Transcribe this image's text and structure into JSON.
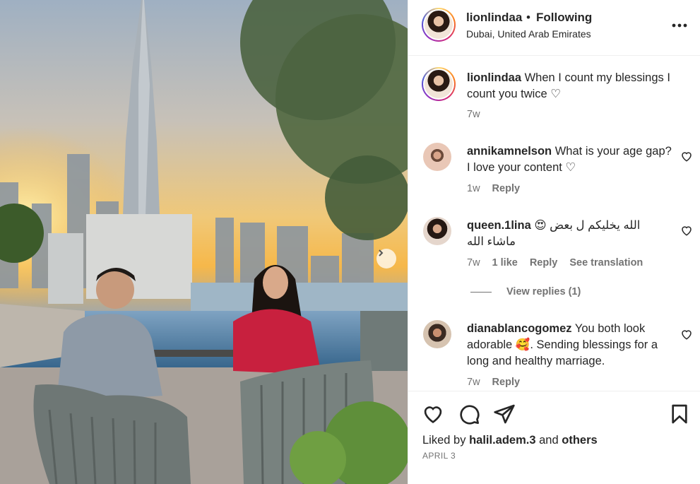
{
  "post": {
    "username": "lionlindaa",
    "separator": "•",
    "follow_status": "Following",
    "location": "Dubai, United Arab Emirates"
  },
  "caption": {
    "username": "lionlindaa",
    "text": "When I count my blessings I count you twice ♡",
    "time": "7w"
  },
  "comments": [
    {
      "username": "annikamnelson",
      "text": "What is your age gap? I love your content ♡",
      "time": "1w",
      "reply_label": "Reply"
    },
    {
      "username": "queen.1lina",
      "text": "😍 الله يخليكم ل بعض ماشاء الله",
      "time": "7w",
      "likes": "1 like",
      "reply_label": "Reply",
      "translate_label": "See translation"
    },
    {
      "username": "dianablancogomez",
      "text": "You both look adorable 🥰. Sending blessings for a long and healthy marriage.",
      "time": "7w",
      "reply_label": "Reply"
    }
  ],
  "view_replies": "View replies (1)",
  "footer": {
    "liked_by_prefix": "Liked by",
    "liked_by_user": "halil.adem.3",
    "and": "and",
    "others": "others",
    "date": "APRIL 3"
  },
  "icons": {
    "more": "more-horizontal-icon",
    "like": "heart-icon",
    "comment": "comment-icon",
    "share": "share-icon",
    "save": "bookmark-icon",
    "next": "chevron-right-icon"
  }
}
